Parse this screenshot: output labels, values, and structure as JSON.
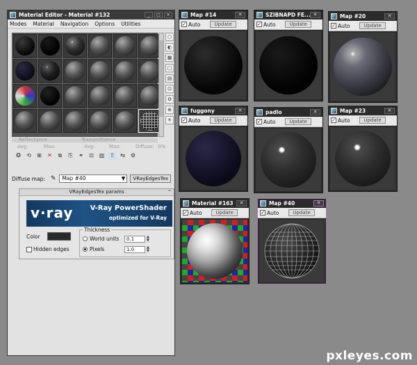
{
  "material_editor": {
    "title": "Material Editor - Material #132",
    "menu": [
      "Modes",
      "Material",
      "Navigation",
      "Options",
      "Utilities"
    ],
    "reflectance_label": "Reflectance",
    "reflectance_avg": "Avg:",
    "reflectance_max": "Max:",
    "transmittance_label": "Transmittance",
    "transmittance_avg": "Avg:",
    "transmittance_max": "Max:",
    "diffuse_label": "Diffuse:",
    "diffuse_value": "0%",
    "diffuse_map_label": "Diffuse map:",
    "map_dropdown_value": "Map #40",
    "map_type_button": "VRayEdgesTex",
    "rollout_title": "VRayEdgesTex params",
    "banner": {
      "logo": "v·ray",
      "line1": "V-Ray PowerShader",
      "line2": "optimized for V-Ray"
    },
    "color_label": "Color",
    "hidden_edges_label": "Hidden edges",
    "thickness_label": "Thickness",
    "world_units_label": "World units",
    "world_units_value": "0.1",
    "pixels_label": "Pixels",
    "pixels_value": "1.0",
    "selected_thickness": "Pixels"
  },
  "map_windows": [
    {
      "title": "Map #14",
      "auto_label": "Auto",
      "update_label": "Update"
    },
    {
      "title": "SZIBNAPD FE...",
      "auto_label": "Auto",
      "update_label": "Update"
    },
    {
      "title": "Map #20",
      "auto_label": "Auto",
      "update_label": "Update"
    },
    {
      "title": "fuggony",
      "auto_label": "Auto",
      "update_label": "Update"
    },
    {
      "title": "padlo",
      "auto_label": "Auto",
      "update_label": "Update"
    },
    {
      "title": "Map #23",
      "auto_label": "Auto",
      "update_label": "Update"
    },
    {
      "title": "Material #163",
      "auto_label": "Auto",
      "update_label": "Update"
    },
    {
      "title": "Map #40",
      "auto_label": "Auto",
      "update_label": "Update"
    }
  ],
  "watermark": "pxleyes.com",
  "colors": {
    "titlebar": "#2b2b2b",
    "vray_blue": "#1e5386",
    "map40_accent": "#b070c0"
  }
}
